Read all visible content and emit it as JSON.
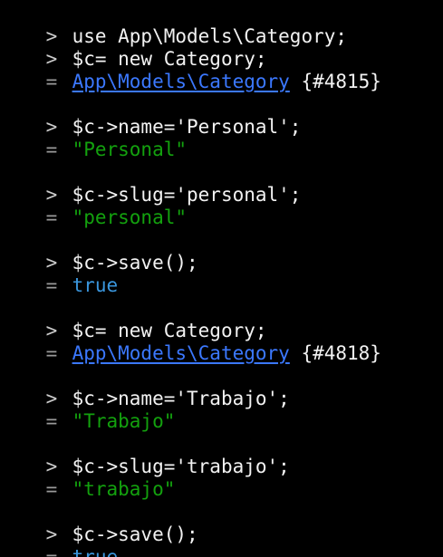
{
  "terminal": {
    "cut_line": ">",
    "prompt": ">",
    "result_marker": "=",
    "entries": [
      {
        "input": "use App\\Models\\Category;"
      },
      {
        "input": "$c= new Category;",
        "result_class": "App\\Models\\Category",
        "result_id": "{#4815}"
      },
      {
        "input": "$c->name='Personal';",
        "result": "\"Personal\""
      },
      {
        "input": "$c->slug='personal';",
        "result": "\"personal\""
      },
      {
        "input": "$c->save();",
        "result": "true"
      },
      {
        "input": "$c= new Category;",
        "result_class": "App\\Models\\Category",
        "result_id": "{#4818}"
      },
      {
        "input": "$c->name='Trabajo';",
        "result": "\"Trabajo\""
      },
      {
        "input": "$c->slug='trabajo';",
        "result": "\"trabajo\""
      },
      {
        "input": "$c->save();",
        "result": "true"
      }
    ]
  },
  "colors": {
    "background": "#000000",
    "text": "#f2f2f2",
    "link": "#3b78ff",
    "string": "#13a10e",
    "boolean": "#3a96dd"
  }
}
